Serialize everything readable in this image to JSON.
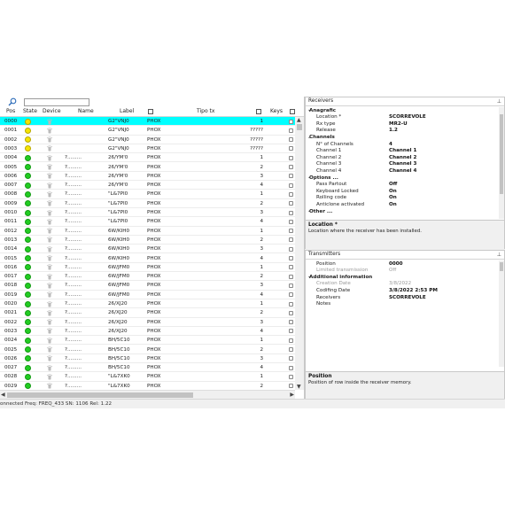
{
  "toolbar": {
    "search_placeholder": ""
  },
  "columns": {
    "pos": "Pos",
    "state": "State",
    "device": "Device",
    "name": "Name",
    "label": "Label",
    "tipo_tx": "Tipo tx",
    "keys": "Keys"
  },
  "colors": {
    "selected": "#00ffff",
    "green": "#22cc22",
    "yellow": "#f5e400"
  },
  "rows": [
    {
      "pos": "0000",
      "state": "yellow",
      "name": "",
      "label": "G2\"VNJ0",
      "type": "PHOX",
      "keys": "1",
      "selected": true
    },
    {
      "pos": "0001",
      "state": "yellow",
      "name": "",
      "label": "G2\"VNJ0",
      "type": "PHOX",
      "keys": "?????"
    },
    {
      "pos": "0002",
      "state": "yellow",
      "name": "",
      "label": "G2\"VNJ0",
      "type": "PHOX",
      "keys": "?????"
    },
    {
      "pos": "0003",
      "state": "yellow",
      "name": "",
      "label": "G2\"VNJ0",
      "type": "PHOX",
      "keys": "?????"
    },
    {
      "pos": "0004",
      "state": "green",
      "name": "?.........",
      "label": "26/YM'0",
      "type": "PHOX",
      "keys": "1"
    },
    {
      "pos": "0005",
      "state": "green",
      "name": "?.........",
      "label": "26/YM'0",
      "type": "PHOX",
      "keys": "2"
    },
    {
      "pos": "0006",
      "state": "green",
      "name": "?.........",
      "label": "26/YM'0",
      "type": "PHOX",
      "keys": "3"
    },
    {
      "pos": "0007",
      "state": "green",
      "name": "?.........",
      "label": "26/YM'0",
      "type": "PHOX",
      "keys": "4"
    },
    {
      "pos": "0008",
      "state": "green",
      "name": "?.........",
      "label": "\"L&7PI0",
      "type": "PHOX",
      "keys": "1"
    },
    {
      "pos": "0009",
      "state": "green",
      "name": "?.........",
      "label": "\"L&7PI0",
      "type": "PHOX",
      "keys": "2"
    },
    {
      "pos": "0010",
      "state": "green",
      "name": "?.........",
      "label": "\"L&7PI0",
      "type": "PHOX",
      "keys": "3"
    },
    {
      "pos": "0011",
      "state": "green",
      "name": "?.........",
      "label": "\"L&7PI0",
      "type": "PHOX",
      "keys": "4"
    },
    {
      "pos": "0012",
      "state": "green",
      "name": "?.........",
      "label": "6W/KIH0",
      "type": "PHOX",
      "keys": "1"
    },
    {
      "pos": "0013",
      "state": "green",
      "name": "?.........",
      "label": "6W/KIH0",
      "type": "PHOX",
      "keys": "2"
    },
    {
      "pos": "0014",
      "state": "green",
      "name": "?.........",
      "label": "6W/KIH0",
      "type": "PHOX",
      "keys": "3"
    },
    {
      "pos": "0015",
      "state": "green",
      "name": "?.........",
      "label": "6W/KIH0",
      "type": "PHOX",
      "keys": "4"
    },
    {
      "pos": "0016",
      "state": "green",
      "name": "?.........",
      "label": "6W/JFM0",
      "type": "PHOX",
      "keys": "1"
    },
    {
      "pos": "0017",
      "state": "green",
      "name": "?.........",
      "label": "6W/JFM0",
      "type": "PHOX",
      "keys": "2"
    },
    {
      "pos": "0018",
      "state": "green",
      "name": "?.........",
      "label": "6W/JFM0",
      "type": "PHOX",
      "keys": "3"
    },
    {
      "pos": "0019",
      "state": "green",
      "name": "?.........",
      "label": "6W/JFM0",
      "type": "PHOX",
      "keys": "4"
    },
    {
      "pos": "0020",
      "state": "green",
      "name": "?.........",
      "label": "26/XJ20",
      "type": "PHOX",
      "keys": "1"
    },
    {
      "pos": "0021",
      "state": "green",
      "name": "?.........",
      "label": "26/XJ20",
      "type": "PHOX",
      "keys": "2"
    },
    {
      "pos": "0022",
      "state": "green",
      "name": "?.........",
      "label": "26/XJ20",
      "type": "PHOX",
      "keys": "3"
    },
    {
      "pos": "0023",
      "state": "green",
      "name": "?.........",
      "label": "26/XJ20",
      "type": "PHOX",
      "keys": "4"
    },
    {
      "pos": "0024",
      "state": "green",
      "name": "?.........",
      "label": "BH/5C10",
      "type": "PHOX",
      "keys": "1"
    },
    {
      "pos": "0025",
      "state": "green",
      "name": "?.........",
      "label": "BH/5C10",
      "type": "PHOX",
      "keys": "2"
    },
    {
      "pos": "0026",
      "state": "green",
      "name": "?.........",
      "label": "BH/5C10",
      "type": "PHOX",
      "keys": "3"
    },
    {
      "pos": "0027",
      "state": "green",
      "name": "?.........",
      "label": "BH/5C10",
      "type": "PHOX",
      "keys": "4"
    },
    {
      "pos": "0028",
      "state": "green",
      "name": "?.........",
      "label": "\"L&7XK0",
      "type": "PHOX",
      "keys": "1"
    },
    {
      "pos": "0029",
      "state": "green",
      "name": "?.........",
      "label": "\"L&7XK0",
      "type": "PHOX",
      "keys": "2"
    }
  ],
  "receivers": {
    "title": "Receivers",
    "props": [
      {
        "kind": "cat",
        "k": "Anagrafic"
      },
      {
        "k": "Location *",
        "v": "SCORREVOLE"
      },
      {
        "k": "Rx type",
        "v": "MR2-U"
      },
      {
        "k": "Release",
        "v": "1.2"
      },
      {
        "kind": "cat",
        "k": "Channels"
      },
      {
        "k": "N° of Channels",
        "v": "4"
      },
      {
        "k": "Channel 1",
        "v": "Channel 1"
      },
      {
        "k": "Channel 2",
        "v": "Channel 2"
      },
      {
        "k": "Channel 3",
        "v": "Channel 3"
      },
      {
        "k": "Channel 4",
        "v": "Channel 4"
      },
      {
        "kind": "cat",
        "k": "Options ..."
      },
      {
        "k": "Pass Partout",
        "v": "Off"
      },
      {
        "k": "Keyboard Locked",
        "v": "On"
      },
      {
        "k": "Rolling code",
        "v": "On"
      },
      {
        "k": "Anticlone activated",
        "v": "On"
      },
      {
        "kind": "cat",
        "k": "Other ..."
      }
    ],
    "desc_title": "Location *",
    "desc_text": "Location where the receiver has been installed."
  },
  "transmitters": {
    "title": "Transmitters",
    "props": [
      {
        "k": "Position",
        "v": "0000"
      },
      {
        "k": "Limited transmission",
        "v": "Off",
        "gray": true
      },
      {
        "kind": "cat",
        "k": "Additional information"
      },
      {
        "k": "Creation Date",
        "v": "3/8/2022",
        "gray": true
      },
      {
        "k": "Codifing Date",
        "v": "3/8/2022 2:53 PM"
      },
      {
        "k": "Receivers",
        "v": "SCORREVOLE"
      },
      {
        "k": "Notes",
        "v": ""
      }
    ],
    "desc_title": "Position",
    "desc_text": "Position of row inside the receiver memory."
  },
  "status": "onnected Freq: FREQ_433 SN: 1106 Rel: 1.22"
}
